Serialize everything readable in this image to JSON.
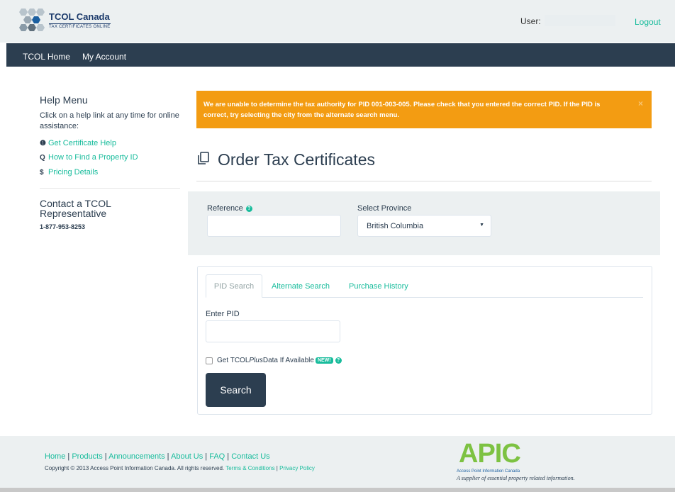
{
  "header": {
    "logo_title": "TCOL Canada",
    "logo_subtitle": "TAX CERTIFICATES ONLINE",
    "user_label": "User:",
    "logout_label": "Logout"
  },
  "nav": {
    "items": [
      "TCOL Home",
      "My Account"
    ]
  },
  "sidebar": {
    "help_title": "Help Menu",
    "help_description": "Click on a help link at any time for online assistance:",
    "links": [
      {
        "icon": "info-circle-icon",
        "glyph": "❶",
        "label": "Get Certificate Help"
      },
      {
        "icon": "search-icon",
        "glyph": "Q",
        "label": "How to Find a Property ID"
      },
      {
        "icon": "dollar-icon",
        "glyph": "$",
        "label": "Pricing Details"
      }
    ],
    "contact_title": "Contact a TCOL Representative",
    "contact_phone": "1-877-953-8253"
  },
  "alert": {
    "message": "We are unable to determine the tax authority for PID 001-003-005. Please check that you entered the correct PID. If the PID is correct, try selecting the city from the alternate search menu.",
    "close": "×",
    "color": "#f39c12"
  },
  "page": {
    "title": "Order Tax Certificates",
    "title_icon": "copy-icon"
  },
  "order_form": {
    "reference_label": "Reference",
    "reference_value": "",
    "province_label": "Select Province",
    "province_value": "British Columbia"
  },
  "search": {
    "tabs": [
      "PID Search",
      "Alternate Search",
      "Purchase History"
    ],
    "active_tab": "PID Search",
    "pid_label": "Enter PID",
    "pid_value": "",
    "checkbox_label_pre": "Get TCOL ",
    "checkbox_label_em": "Plus",
    "checkbox_label_post": " Data If Available",
    "new_badge": "NEW!",
    "button_label": "Search"
  },
  "footer": {
    "links": [
      "Home",
      "Products",
      "Announcements",
      "About Us",
      "FAQ",
      "Contact Us"
    ],
    "copyright": "Copyright © 2013 Access Point Information Canada. All rights reserved.",
    "terms_label": "Terms & Conditions",
    "privacy_label": "Privacy Policy",
    "apic_logo": "APIC",
    "apic_name": "Access Point Information Canada",
    "apic_tagline": "A supplier of essential property related information."
  },
  "colors": {
    "accent": "#18bc9c",
    "navbar": "#2c3e50",
    "warning": "#f39c12",
    "apic_green": "#7dc242"
  }
}
